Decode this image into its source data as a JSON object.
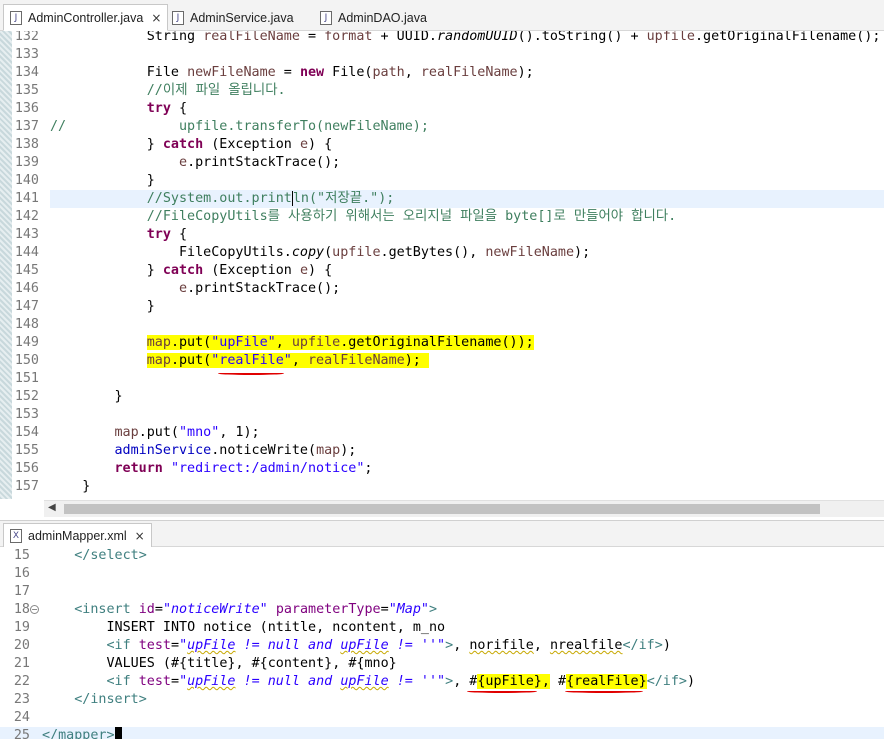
{
  "tabs_top": [
    {
      "label": "AdminController.java",
      "icon": "J",
      "active": true,
      "close": "×"
    },
    {
      "label": "AdminService.java",
      "icon": "J",
      "active": false
    },
    {
      "label": "AdminDAO.java",
      "icon": "J",
      "active": false
    }
  ],
  "java_lines": [
    {
      "n": "132",
      "html": "            <span class=\"txt\">String </span><span class=\"var\">realFileName</span> = <span class=\"var\">format</span> + UUID.<span class=\"ital\">randomUUID</span>().toString() + <span class=\"var\">upfile</span>.getOriginalFilename();"
    },
    {
      "n": "133",
      "html": ""
    },
    {
      "n": "134",
      "html": "            File <span class=\"var\">newFileName</span> = <span class=\"kw\">new</span> File(<span class=\"var\">path</span>, <span class=\"var\">realFileName</span>);"
    },
    {
      "n": "135",
      "html": "            <span class=\"cmt\">//이제 파일 올립니다.</span>"
    },
    {
      "n": "136",
      "html": "            <span class=\"kw\">try</span> {"
    },
    {
      "n": "137",
      "html": "<span class=\"cmt\">//              upfile.transferTo(newFileName);</span>"
    },
    {
      "n": "138",
      "html": "            } <span class=\"kw\">catch</span> (Exception <span class=\"var\">e</span>) {"
    },
    {
      "n": "139",
      "html": "                <span class=\"var\">e</span>.printStackTrace();"
    },
    {
      "n": "140",
      "html": "            }"
    },
    {
      "n": "141",
      "html": "            <span class=\"cmt\">//System.out.print<span class=\"caret\"></span>ln(\"저장끝.\");</span>",
      "current": true
    },
    {
      "n": "142",
      "html": "            <span class=\"cmt\">//FileCopyUtils를 사용하기 위해서는 오리지널 파일을 byte[]로 만들어야 합니다.</span>"
    },
    {
      "n": "143",
      "html": "            <span class=\"kw\">try</span> {"
    },
    {
      "n": "144",
      "html": "                FileCopyUtils.<span class=\"ital\">copy</span>(<span class=\"var\">upfile</span>.getBytes(), <span class=\"var\">newFileName</span>);"
    },
    {
      "n": "145",
      "html": "            } <span class=\"kw\">catch</span> (Exception <span class=\"var\">e</span>) {"
    },
    {
      "n": "146",
      "html": "                <span class=\"var\">e</span>.printStackTrace();"
    },
    {
      "n": "147",
      "html": "            }"
    },
    {
      "n": "148",
      "html": ""
    },
    {
      "n": "149",
      "html": "            <span class=\"hl\"><span class=\"var\">map</span>.put(<span class=\"str\">\"upFile\"</span>, <span class=\"var\">upfile</span>.getOriginalFilename());</span>"
    },
    {
      "n": "150",
      "html": "            <span class=\"hl\"><span class=\"var\">map</span>.put(<span class=\"str\">\"realFile\"</span>, <span class=\"var\">realFileName</span>);&nbsp;</span>"
    },
    {
      "n": "151",
      "html": ""
    },
    {
      "n": "152",
      "html": "        }"
    },
    {
      "n": "153",
      "html": ""
    },
    {
      "n": "154",
      "html": "        <span class=\"var\">map</span>.put(<span class=\"str\">\"mno\"</span>, 1);"
    },
    {
      "n": "155",
      "html": "        <span class=\"fld\">adminService</span>.noticeWrite(<span class=\"var\">map</span>);"
    },
    {
      "n": "156",
      "html": "        <span class=\"kw\">return</span> <span class=\"str\">\"redirect:/admin/notice\"</span>;"
    },
    {
      "n": "157",
      "html": "    }"
    }
  ],
  "tab_bottom": {
    "label": "adminMapper.xml",
    "icon": "X",
    "close": "×"
  },
  "xml_lines": [
    {
      "n": "15",
      "html": "    <span class=\"tag\">&lt;/select&gt;</span>"
    },
    {
      "n": "16",
      "html": ""
    },
    {
      "n": "17",
      "html": ""
    },
    {
      "n": "18",
      "html": "    <span class=\"tag\">&lt;insert</span> <span class=\"attr\">id</span>=<span class=\"aval\">\"noticeWrite\"</span> <span class=\"attr\">parameterType</span>=<span class=\"aval\">\"Map\"</span><span class=\"tag\">&gt;</span>",
      "fold": true
    },
    {
      "n": "19",
      "html": "        INSERT INTO notice (ntitle, ncontent, m_no"
    },
    {
      "n": "20",
      "html": "        <span class=\"tag\">&lt;if</span> <span class=\"attr\">test</span>=<span class=\"aval\">\"<span class=\"squig\">upFile</span> != null and <span class=\"squig\">upFile</span> != ''\"</span><span class=\"tag\">&gt;</span>, <span class=\"squig\">norifile</span>, <span class=\"squig\">nrealfile</span><span class=\"tag\">&lt;/if&gt;</span>)"
    },
    {
      "n": "21",
      "html": "        VALUES (#{title}, #{content}, #{mno}"
    },
    {
      "n": "22",
      "html": "        <span class=\"tag\">&lt;if</span> <span class=\"attr\">test</span>=<span class=\"aval\">\"<span class=\"squig\">upFile</span> != null and <span class=\"squig\">upFile</span> != ''\"</span><span class=\"tag\">&gt;</span>, #<span class=\"hl\">{upFile},</span> #<span class=\"hl\">{realFile}</span><span class=\"tag\">&lt;/if&gt;</span>)"
    },
    {
      "n": "23",
      "html": "    <span class=\"tag\">&lt;/insert&gt;</span>"
    },
    {
      "n": "24",
      "html": ""
    },
    {
      "n": "25",
      "html": "<span class=\"tag\">&lt;/mapper&gt;</span><span style=\"display:inline-block;width:7px;height:15px;background:#000;vertical-align:-3px;\"></span>",
      "last": true
    }
  ]
}
